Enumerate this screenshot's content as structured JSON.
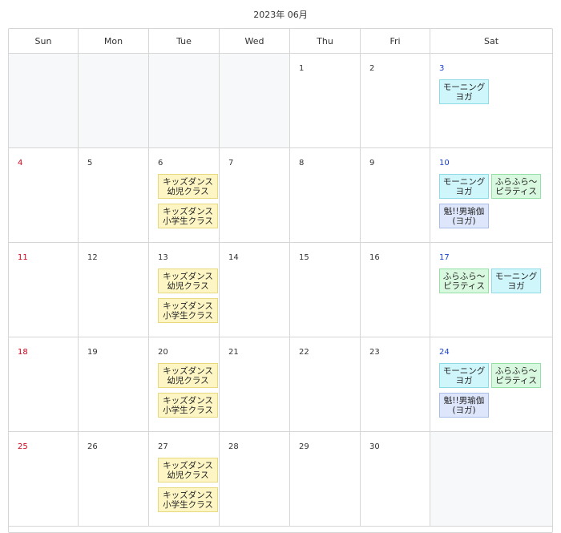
{
  "title": "2023年 06月",
  "weekdays": [
    "Sun",
    "Mon",
    "Tue",
    "Wed",
    "Thu",
    "Fri",
    "Sat"
  ],
  "colors": {
    "sunday": "#d0021b",
    "saturday": "#1a3fd0",
    "dance_bg": "#fdf6c4",
    "yoga_bg": "#cff6fb",
    "pilates_bg": "#d8f9df",
    "men_yoga_bg": "#dde6fb",
    "empty_bg": "#f7f8fa"
  },
  "weeks": [
    [
      {
        "day": "",
        "events": []
      },
      {
        "day": "",
        "events": []
      },
      {
        "day": "",
        "events": []
      },
      {
        "day": "",
        "events": []
      },
      {
        "day": "1",
        "events": []
      },
      {
        "day": "2",
        "events": []
      },
      {
        "day": "3",
        "events": [
          {
            "label": "モーニング\nヨガ",
            "type": "yoga"
          }
        ]
      }
    ],
    [
      {
        "day": "4",
        "events": []
      },
      {
        "day": "5",
        "events": []
      },
      {
        "day": "6",
        "events": [
          {
            "label": "キッズダンス\n幼児クラス",
            "type": "dance"
          },
          {
            "label": "キッズダンス\n小学生クラス",
            "type": "dance"
          }
        ]
      },
      {
        "day": "7",
        "events": []
      },
      {
        "day": "8",
        "events": []
      },
      {
        "day": "9",
        "events": []
      },
      {
        "day": "10",
        "events": [
          {
            "label": "モーニング\nヨガ",
            "type": "yoga"
          },
          {
            "label": "ふらふら〜\nピラティス",
            "type": "pilates"
          },
          {
            "label": "魁!!男瑜伽\n(ヨガ)",
            "type": "men"
          }
        ]
      }
    ],
    [
      {
        "day": "11",
        "events": []
      },
      {
        "day": "12",
        "events": []
      },
      {
        "day": "13",
        "events": [
          {
            "label": "キッズダンス\n幼児クラス",
            "type": "dance"
          },
          {
            "label": "キッズダンス\n小学生クラス",
            "type": "dance"
          }
        ]
      },
      {
        "day": "14",
        "events": []
      },
      {
        "day": "15",
        "events": []
      },
      {
        "day": "16",
        "events": []
      },
      {
        "day": "17",
        "events": [
          {
            "label": "ふらふら〜\nピラティス",
            "type": "pilates"
          },
          {
            "label": "モーニング\nヨガ",
            "type": "yoga"
          }
        ]
      }
    ],
    [
      {
        "day": "18",
        "events": []
      },
      {
        "day": "19",
        "events": []
      },
      {
        "day": "20",
        "events": [
          {
            "label": "キッズダンス\n幼児クラス",
            "type": "dance"
          },
          {
            "label": "キッズダンス\n小学生クラス",
            "type": "dance"
          }
        ]
      },
      {
        "day": "21",
        "events": []
      },
      {
        "day": "22",
        "events": []
      },
      {
        "day": "23",
        "events": []
      },
      {
        "day": "24",
        "events": [
          {
            "label": "モーニング\nヨガ",
            "type": "yoga"
          },
          {
            "label": "ふらふら〜\nピラティス",
            "type": "pilates"
          },
          {
            "label": "魁!!男瑜伽\n(ヨガ)",
            "type": "men"
          }
        ]
      }
    ],
    [
      {
        "day": "25",
        "events": []
      },
      {
        "day": "26",
        "events": []
      },
      {
        "day": "27",
        "events": [
          {
            "label": "キッズダンス\n幼児クラス",
            "type": "dance"
          },
          {
            "label": "キッズダンス\n小学生クラス",
            "type": "dance"
          }
        ]
      },
      {
        "day": "28",
        "events": []
      },
      {
        "day": "29",
        "events": []
      },
      {
        "day": "30",
        "events": []
      },
      {
        "day": "",
        "events": []
      }
    ]
  ]
}
